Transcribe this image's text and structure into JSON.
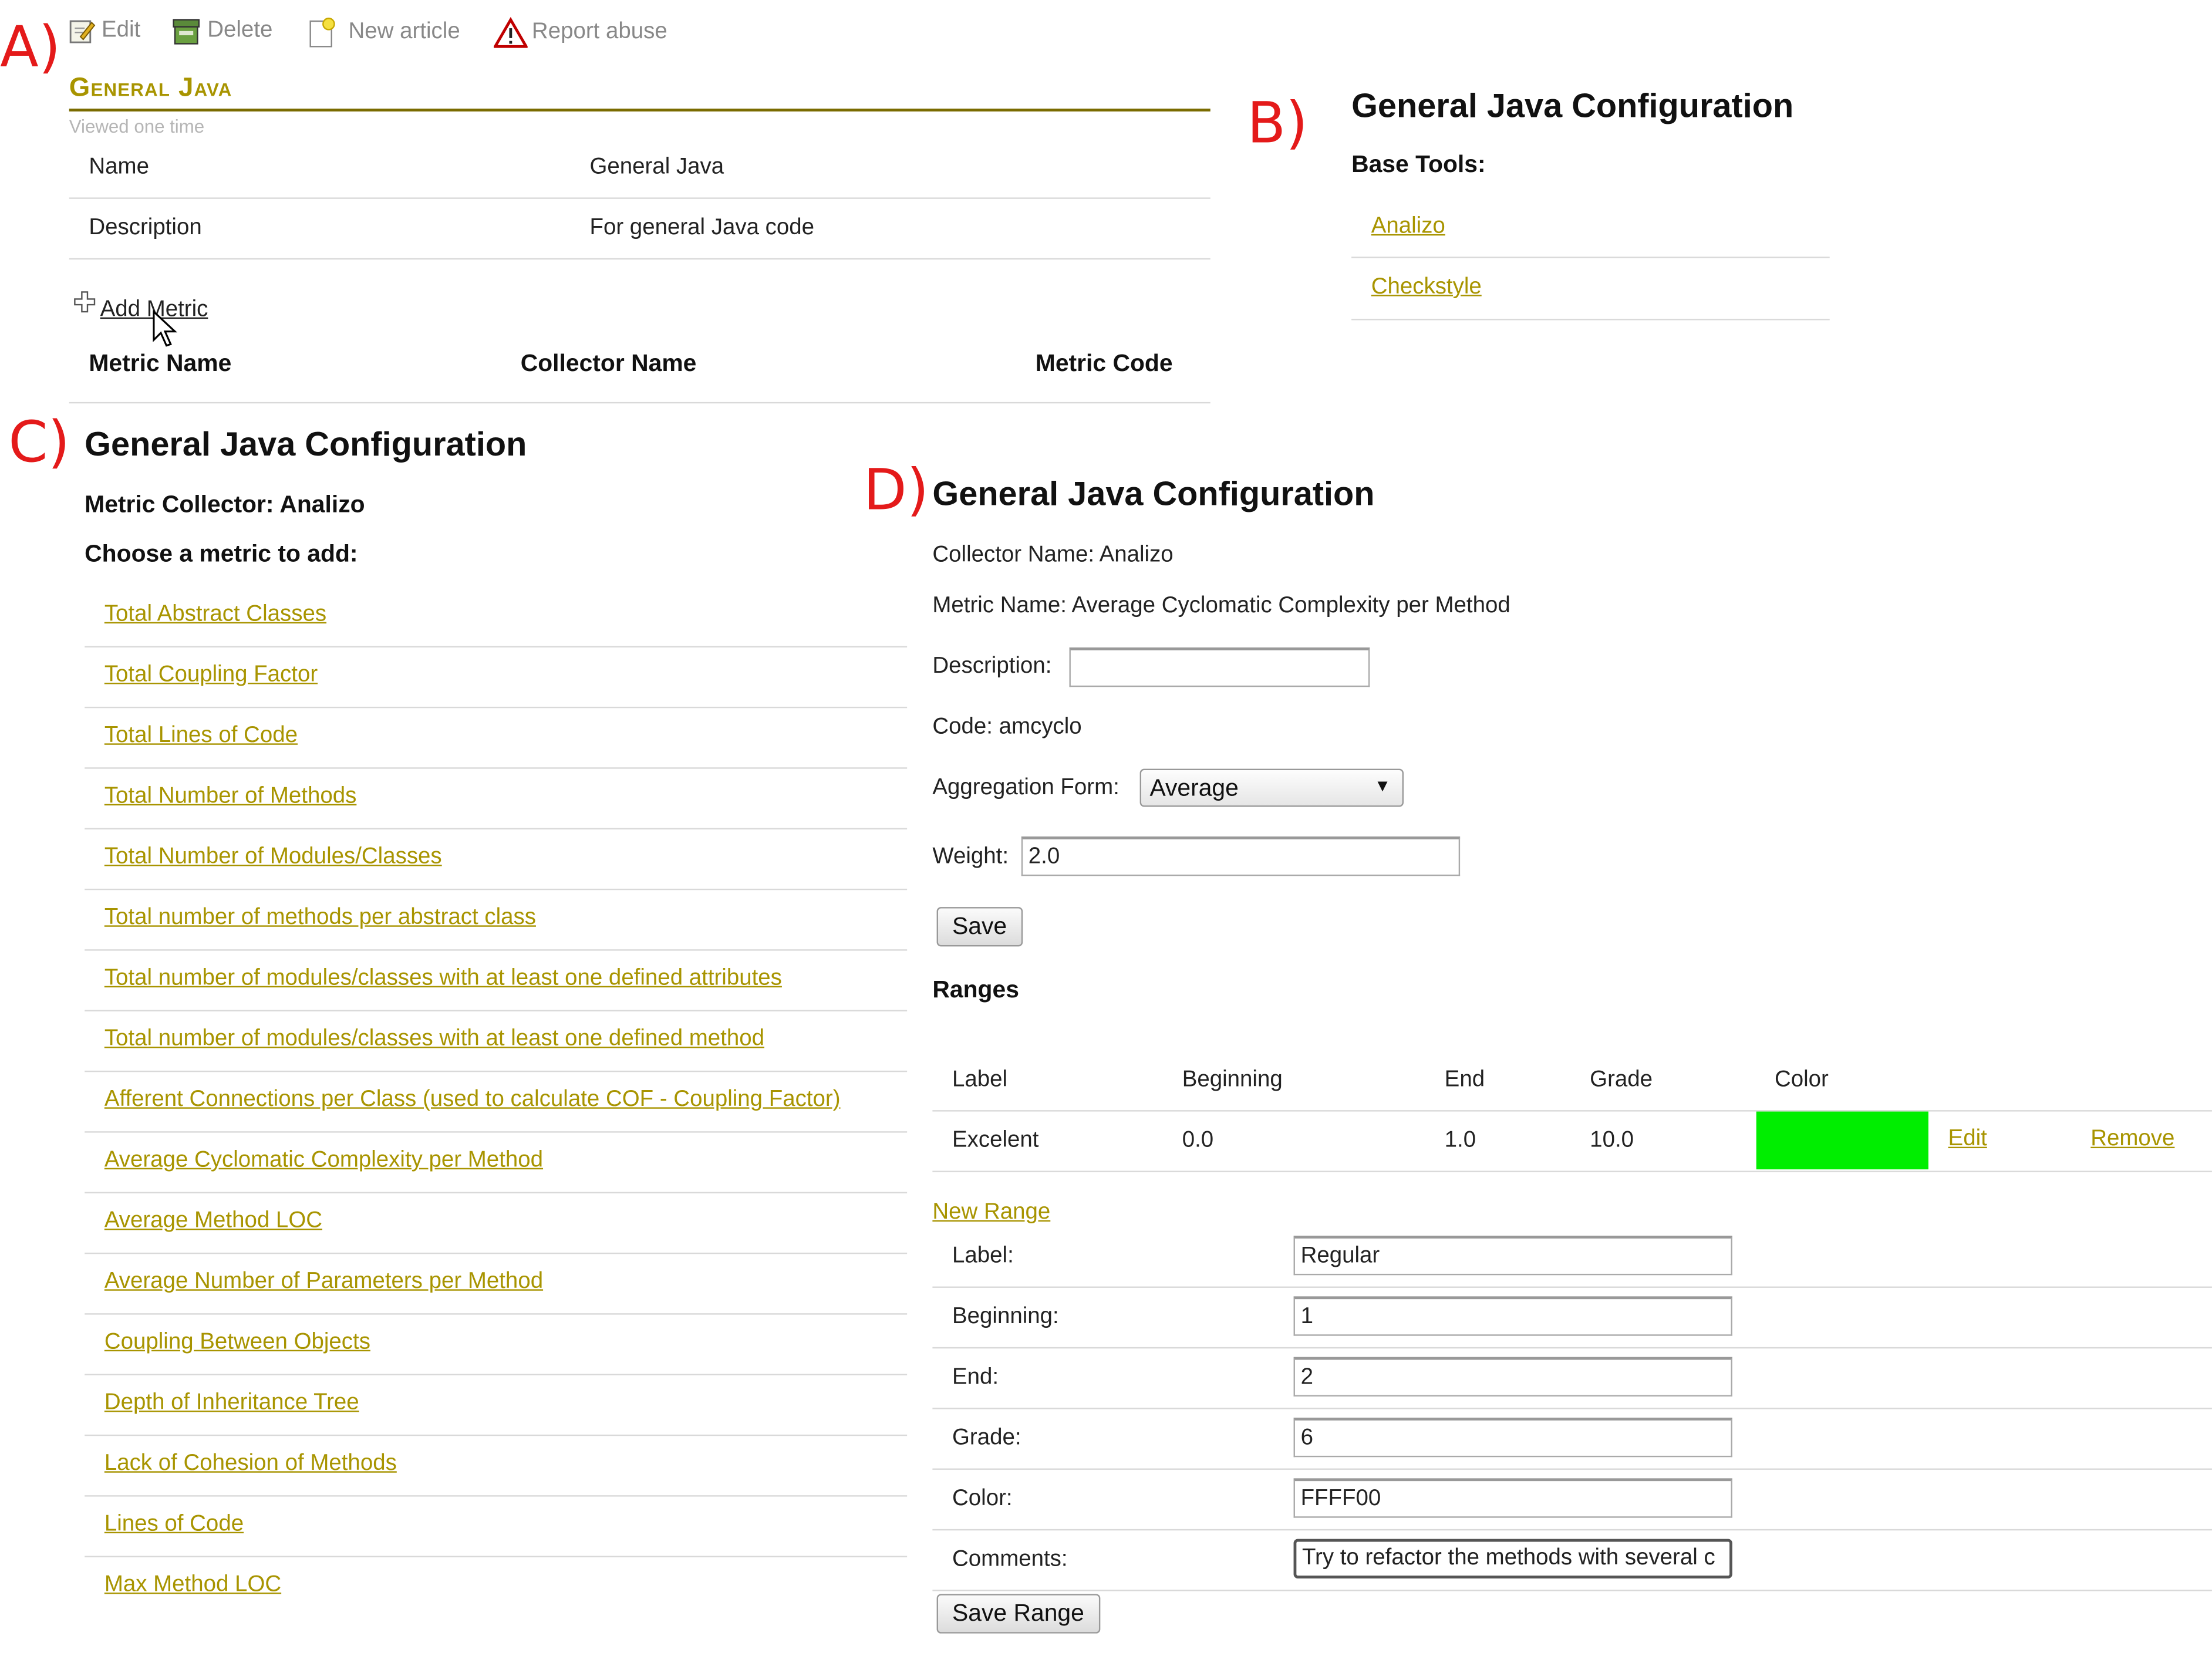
{
  "panel_labels": {
    "a": "A)",
    "b": "B)",
    "c": "C)",
    "d": "D)"
  },
  "toolbar": {
    "edit": "Edit",
    "delete": "Delete",
    "new_article": "New article",
    "report_abuse": "Report abuse"
  },
  "panel_a": {
    "title": "General Java",
    "viewed": "Viewed one time",
    "info_rows": [
      {
        "label": "Name",
        "value": "General Java"
      },
      {
        "label": "Description",
        "value": "For general Java code"
      }
    ],
    "add_metric": "Add Metric",
    "columns": [
      "Metric Name",
      "Collector Name",
      "Metric Code"
    ]
  },
  "panel_b": {
    "title": "General Java Configuration",
    "subtitle": "Base Tools:",
    "tools": [
      "Analizo",
      "Checkstyle"
    ]
  },
  "panel_c": {
    "title": "General Java Configuration",
    "collector": "Metric Collector: Analizo",
    "choose": "Choose a metric to add:",
    "metrics": [
      "Total Abstract Classes",
      "Total Coupling Factor",
      "Total Lines of Code",
      "Total Number of Methods",
      "Total Number of Modules/Classes",
      "Total number of methods per abstract class",
      "Total number of modules/classes with at least one defined attributes",
      "Total number of modules/classes with at least one defined method",
      "Afferent Connections per Class (used to calculate COF - Coupling Factor)",
      "Average Cyclomatic Complexity per Method",
      "Average Method LOC",
      "Average Number of Parameters per Method",
      "Coupling Between Objects",
      "Depth of Inheritance Tree",
      "Lack of Cohesion of Methods",
      "Lines of Code",
      "Max Method LOC"
    ]
  },
  "panel_d": {
    "title": "General Java Configuration",
    "collector": "Collector Name: Analizo",
    "metric": "Metric Name: Average Cyclomatic Complexity per Method",
    "description_label": "Description:",
    "description_value": "",
    "code": "Code: amcyclo",
    "aggregation_label": "Aggregation Form:",
    "aggregation_value": "Average",
    "weight_label": "Weight:",
    "weight_value": "2.0",
    "save": "Save",
    "ranges_title": "Ranges",
    "range_columns": [
      "Label",
      "Beginning",
      "End",
      "Grade",
      "Color"
    ],
    "range_rows": [
      {
        "label": "Excelent",
        "beginning": "0.0",
        "end": "1.0",
        "grade": "10.0",
        "color": "#00ee00",
        "edit": "Edit",
        "remove": "Remove"
      }
    ],
    "new_range": "New Range",
    "form": [
      {
        "label": "Label:",
        "value": "Regular"
      },
      {
        "label": "Beginning:",
        "value": "1"
      },
      {
        "label": "End:",
        "value": "2"
      },
      {
        "label": "Grade:",
        "value": "6"
      },
      {
        "label": "Color:",
        "value": "FFFF00"
      },
      {
        "label": "Comments:",
        "value": "Try to refactor the methods with several c"
      }
    ],
    "save_range": "Save Range"
  },
  "colors": {
    "accent": "#a89400",
    "panel_label": "#e41a1a",
    "range_green": "#00ee00"
  }
}
